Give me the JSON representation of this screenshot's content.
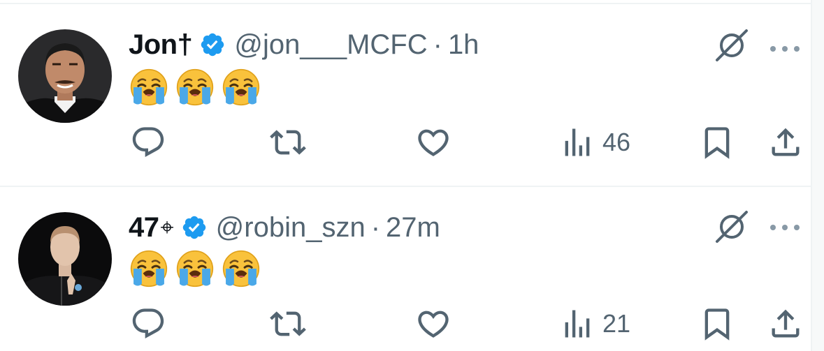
{
  "colors": {
    "text_primary": "#0f1419",
    "text_secondary": "#536471",
    "verified_blue": "#1d9bf0",
    "divider": "#eff3f4"
  },
  "tweets": [
    {
      "display_name": "Jon†",
      "name_glyph": "",
      "handle": "@jon___MCFC",
      "separator": "·",
      "time": "1h",
      "emojis": [
        "loudly-crying-face",
        "loudly-crying-face",
        "loudly-crying-face"
      ],
      "views": "46",
      "icons": {
        "reply": "reply-icon",
        "retweet": "retweet-icon",
        "like": "heart-icon",
        "views": "views-chart-icon",
        "bookmark": "bookmark-icon",
        "share": "share-icon",
        "grok": "grok-icon",
        "more": "more-dots-icon"
      }
    },
    {
      "display_name": "47",
      "name_glyph": "⌖",
      "handle": "@robin_szn",
      "separator": "·",
      "time": "27m",
      "emojis": [
        "loudly-crying-face",
        "loudly-crying-face",
        "loudly-crying-face"
      ],
      "views": "21",
      "icons": {
        "reply": "reply-icon",
        "retweet": "retweet-icon",
        "like": "heart-icon",
        "views": "views-chart-icon",
        "bookmark": "bookmark-icon",
        "share": "share-icon",
        "grok": "grok-icon",
        "more": "more-dots-icon"
      }
    }
  ]
}
